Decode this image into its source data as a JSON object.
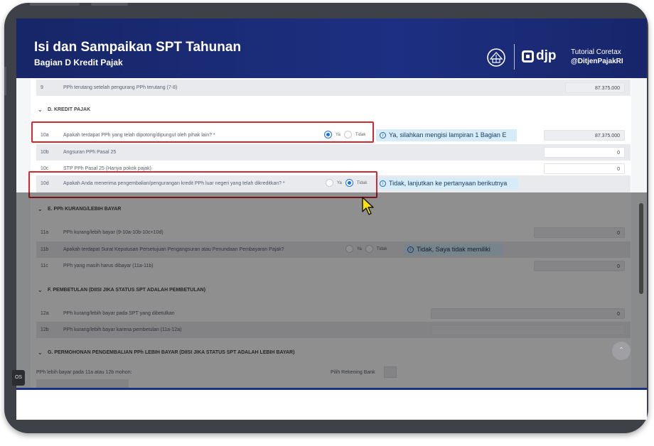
{
  "header": {
    "title": "Isi dan Sampaikan SPT Tahunan",
    "subtitle": "Bagian D Kredit Pajak",
    "logo_text": "djp",
    "tutorial_label": "Tutorial Coretax",
    "handle": "@DitjenPajakRI"
  },
  "top_row": {
    "num": "9",
    "label": "PPh terutang setelah pengurang PPh terutang (7-8)",
    "value": "87.375.000"
  },
  "section_d": {
    "title": "D. KREDIT PAJAK",
    "rows": [
      {
        "num": "10a",
        "label": "Apakah terdapat PPh yang telah dipotong/dipungut oleh pihak lain? *",
        "yes": "Ya",
        "no": "Tidak",
        "selected": "Ya",
        "hint": "Ya, silahkan mengisi lampiran 1 Bagian E",
        "value": "87.375.000"
      },
      {
        "num": "10b",
        "label": "Angsuran PPh Pasal 25",
        "value": "0"
      },
      {
        "num": "10c",
        "label": "STP PPh Pasal 25 (Hanya pokok pajak)",
        "value": "0"
      },
      {
        "num": "10d",
        "label": "Apakah Anda menerima pengembalian/pengurangan kredit PPh luar negeri yang telah dikreditkan? *",
        "yes": "Ya",
        "no": "Tidak",
        "selected": "Tidak",
        "hint": "Tidak, lanjutkan ke pertanyaan berikutnya"
      }
    ]
  },
  "section_e": {
    "title": "E. PPh KURANG/LEBIH BAYAR",
    "rows": [
      {
        "num": "11a",
        "label": "PPh kurang/lebih bayar (9-10a-10b-10c+10d)",
        "value": "0"
      },
      {
        "num": "11b",
        "label": "Apakah terdapat Surat Keputusan Persetujuan Pengangsuran atau Penundaan Pembayaran Pajak?",
        "yes": "Ya",
        "no": "Tidak",
        "hint": "Tidak, Saya tidak memiliki"
      },
      {
        "num": "11c",
        "label": "PPh yang masih harus dibayar (11a-11b)",
        "value": "0"
      }
    ]
  },
  "section_f": {
    "title": "F. PEMBETULAN (DIISI JIKA STATUS SPT ADALAH PEMBETULAN)",
    "rows": [
      {
        "num": "12a",
        "label": "PPh kurang/lebih bayar pada SPT yang dibetulkan",
        "value": "0"
      },
      {
        "num": "12b",
        "label": "PPh kurang/lebih bayar karena pembetulan (11a-12a)",
        "value": ""
      }
    ]
  },
  "section_g": {
    "title": "G. PERMOHONAN PENGEMBALIAN PPh LEBIH BAYAR (DIISI JIKA STATUS SPT ADALAH LEBIH BAYAR)",
    "field_left": "PPh lebih bayar pada 11a atau 12b mohon:",
    "field_right": "Pilih Rekening Bank"
  },
  "os_badge": "OS",
  "colors": {
    "header": "#1d2f82",
    "accent": "#1a73d9",
    "highlight": "#d42a2f",
    "hint_bg": "#d6ecf8"
  }
}
